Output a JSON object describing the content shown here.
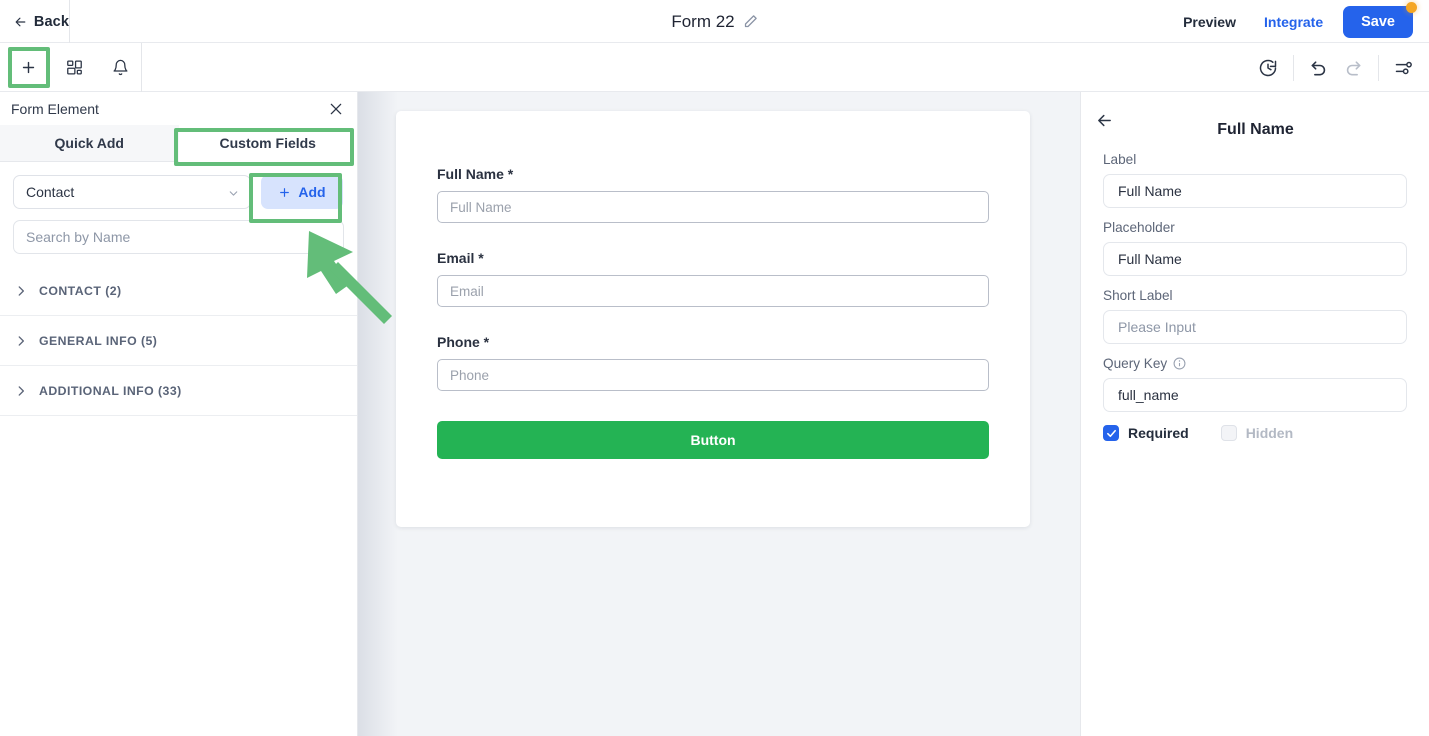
{
  "topbar": {
    "back_label": "Back",
    "form_title": "Form 22",
    "preview_label": "Preview",
    "integrate_label": "Integrate",
    "save_label": "Save",
    "icons": {
      "back": "arrow-left-icon",
      "edit": "pencil-icon",
      "save_badge": "unsaved-changes-dot"
    },
    "colors": {
      "accent": "#2563eb",
      "badge": "#f5a623"
    }
  },
  "toolbar": {
    "left_icons": [
      "plus-icon",
      "grid-layout-icon",
      "bell-icon"
    ],
    "right_icons": [
      "version-history-icon",
      "undo-icon",
      "redo-icon",
      "settings-sliders-icon"
    ]
  },
  "left_panel": {
    "header_title": "Form Element",
    "close_icon": "close-icon",
    "tabs": [
      {
        "label": "Quick Add",
        "active": false
      },
      {
        "label": "Custom Fields",
        "active": true
      }
    ],
    "object_select": {
      "value": "Contact",
      "icon": "chevron-down-icon"
    },
    "add_button": {
      "label": "Add",
      "icon": "plus-icon"
    },
    "search": {
      "placeholder": "Search by Name",
      "value": ""
    },
    "groups": [
      {
        "label": "CONTACT (2)",
        "name": "CONTACT",
        "count": 2,
        "expanded": false
      },
      {
        "label": "GENERAL INFO (5)",
        "name": "GENERAL INFO",
        "count": 5,
        "expanded": false
      },
      {
        "label": "ADDITIONAL INFO (33)",
        "name": "ADDITIONAL INFO",
        "count": 33,
        "expanded": false
      }
    ]
  },
  "canvas": {
    "fields": [
      {
        "label": "Full Name *",
        "placeholder": "Full Name",
        "value": ""
      },
      {
        "label": "Email *",
        "placeholder": "Email",
        "value": ""
      },
      {
        "label": "Phone *",
        "placeholder": "Phone",
        "value": ""
      }
    ],
    "submit_button": {
      "label": "Button",
      "color": "#24b354"
    }
  },
  "right_panel": {
    "back_icon": "arrow-left-icon",
    "title": "Full Name",
    "fields": {
      "label_caption": "Label",
      "label_value": "Full Name",
      "placeholder_caption": "Placeholder",
      "placeholder_value": "Full Name",
      "short_label_caption": "Short Label",
      "short_label_placeholder": "Please Input",
      "short_label_value": "",
      "query_key_caption": "Query Key",
      "query_key_info_icon": "info-icon",
      "query_key_value": "full_name"
    },
    "checkboxes": [
      {
        "label": "Required",
        "checked": true,
        "disabled": false
      },
      {
        "label": "Hidden",
        "checked": false,
        "disabled": true
      }
    ]
  },
  "annotations": {
    "highlight_color": "#63bd79",
    "boxes": [
      "plus-toolbar-button",
      "custom-fields-tab",
      "add-button"
    ],
    "arrow": "points-to-add-button"
  }
}
